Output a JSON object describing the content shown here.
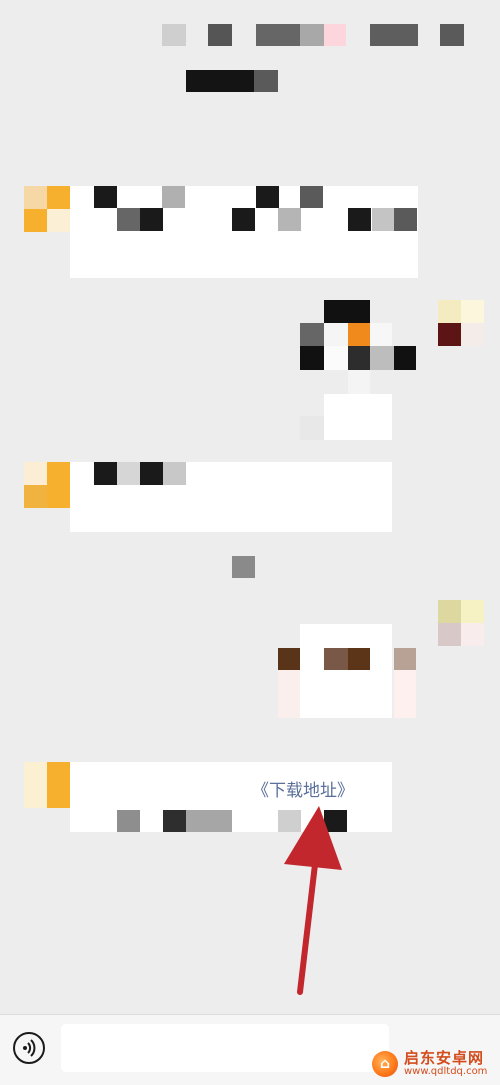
{
  "chat": {
    "link_text": "《下载地址》"
  },
  "watermark": {
    "name": "启东安卓网",
    "domain": "www.qdltdq.com"
  },
  "colors": {
    "background": "#ededed",
    "bubble": "#ffffff",
    "link": "#5a6f9a",
    "arrow": "#c1272d",
    "avatar_orange": "#f7b02e"
  },
  "icons": {
    "voice": "voice-input-icon",
    "arrow": "red-arrow-annotation",
    "watermark_logo": "brand-logo-icon"
  }
}
